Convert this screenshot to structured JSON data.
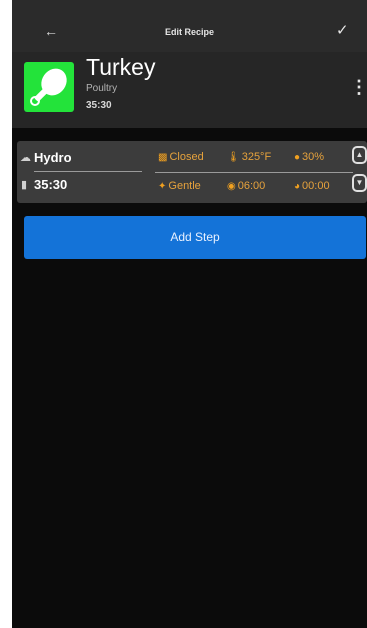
{
  "topbar": {
    "back_icon": "arrow-left-icon",
    "title": "Edit Recipe",
    "confirm_icon": "checkmark-icon"
  },
  "recipe": {
    "thumbnail_icon": "drumstick-icon",
    "thumbnail_color": "#23e33a",
    "name": "Turkey",
    "category": "Poultry",
    "total_time": "35:30",
    "menu_icon": "more-vertical-icon"
  },
  "step": {
    "mode_icon": "steam-icon",
    "mode": "Hydro",
    "time_icon": "timer-icon",
    "time": "35:30",
    "vent": {
      "icon": "vent-icon",
      "label": "Closed"
    },
    "temperature": {
      "icon": "thermometer-icon",
      "label": "325°F"
    },
    "humidity": {
      "icon": "humidity-icon",
      "label": "30%"
    },
    "fan": {
      "icon": "fan-icon",
      "label": "Gentle"
    },
    "duration": {
      "icon": "clock-icon",
      "label": "06:00"
    },
    "delay": {
      "icon": "delay-icon",
      "label": "00:00"
    },
    "move_up_icon": "chevron-up-icon",
    "move_down_icon": "chevron-down-icon"
  },
  "actions": {
    "add_step_label": "Add Step"
  },
  "colors": {
    "accent": "#1473d8",
    "pill_text": "#e6a23c",
    "background": "#0b0b0b"
  }
}
